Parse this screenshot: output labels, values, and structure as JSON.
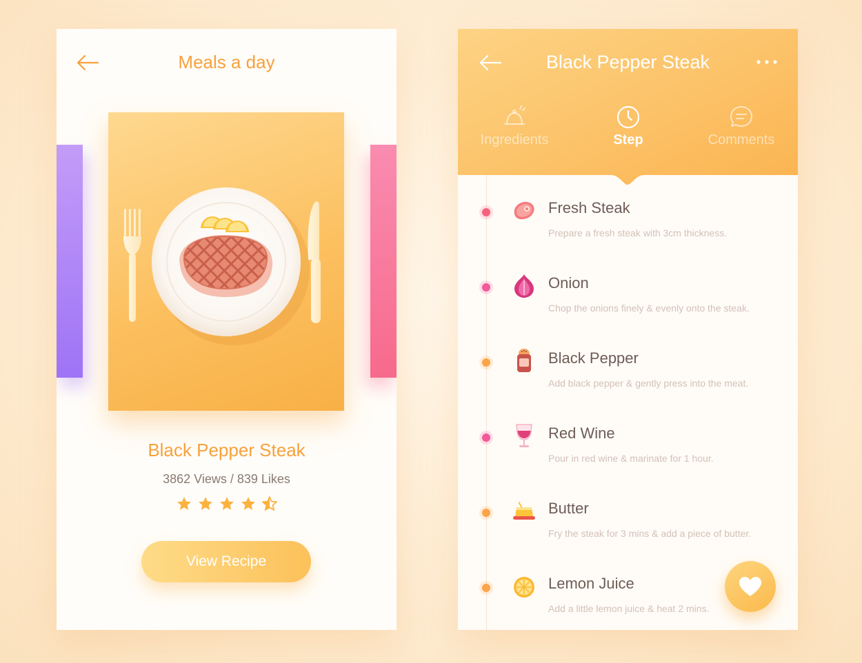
{
  "colors": {
    "accent": "#f7a13c",
    "header_gradient_start": "#fdd384",
    "header_gradient_end": "#fbb451",
    "purple_card": "#a277f6",
    "pink_card": "#f76a8c",
    "text_dark": "#6e5c55",
    "text_light": "#d3c0b8"
  },
  "left_screen": {
    "title": "Meals a day",
    "back_icon": "arrow-left-icon",
    "recipe": {
      "name": "Black Pepper Steak",
      "stats": "3862 Views / 839 Likes",
      "rating": 4.5,
      "rating_max": 5
    },
    "view_button_label": "View Recipe"
  },
  "right_screen": {
    "title": "Black Pepper Steak",
    "back_icon": "arrow-left-icon",
    "more_icon": "more-horizontal-icon",
    "tabs": [
      {
        "label": "Ingredients",
        "icon": "cloche-icon",
        "active": false
      },
      {
        "label": "Step",
        "icon": "clock-icon",
        "active": true
      },
      {
        "label": "Comments",
        "icon": "chat-bubble-icon",
        "active": false
      }
    ],
    "steps": [
      {
        "name": "Fresh Steak",
        "description": "Prepare a fresh steak with 3cm thickness.",
        "icon": "steak-icon",
        "dot_color": "#f7627f"
      },
      {
        "name": "Onion",
        "description": "Chop the onions finely & evenly onto the steak.",
        "icon": "onion-icon",
        "dot_color": "#f25a9a"
      },
      {
        "name": "Black Pepper",
        "description": "Add black pepper & gently press into the meat.",
        "icon": "pepper-shaker-icon",
        "dot_color": "#fba44a"
      },
      {
        "name": "Red Wine",
        "description": "Pour in red wine & marinate for 1 hour.",
        "icon": "wine-glass-icon",
        "dot_color": "#f25a9a"
      },
      {
        "name": "Butter",
        "description": "Fry the steak for 3 mins & add a piece of butter.",
        "icon": "butter-icon",
        "dot_color": "#fba44a"
      },
      {
        "name": "Lemon Juice",
        "description": "Add a little lemon juice & heat 2 mins.",
        "icon": "lemon-icon",
        "dot_color": "#fba44a"
      }
    ],
    "favorite_icon": "heart-icon"
  }
}
